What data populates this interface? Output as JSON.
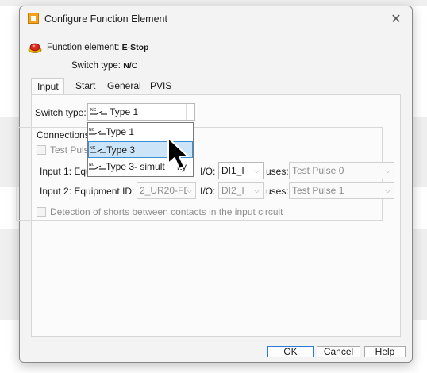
{
  "window": {
    "title": "Configure Function Element",
    "close_glyph": "✕"
  },
  "header": {
    "function_element_label": "Function element:",
    "function_element_value": "E-Stop",
    "switch_type_label": "Switch type:",
    "switch_type_value": "N/C"
  },
  "tabs": [
    {
      "label": "Input",
      "active": true
    },
    {
      "label": "Start"
    },
    {
      "label": "General"
    },
    {
      "label": "PVIS"
    }
  ],
  "form": {
    "switch_type_label": "Switch type:",
    "switch_type_value": "Type 1",
    "connections_label": "Connections",
    "test_pulse_label": "Test Pulse",
    "input1_label": "Input 1: Equ",
    "input2_label": "Input 2: Equipment ID:",
    "input2_equipment_value": "2_UR20-FE",
    "io_label": "I/O:",
    "input1_io_value": "DI1_I",
    "input2_io_value": "DI2_I",
    "uses_label": "uses:",
    "input1_uses_value": "Test Pulse 0",
    "input2_uses_value": "Test Pulse 1",
    "detection_label": "Detection of shorts between contacts in the input circuit"
  },
  "dropdown": {
    "options": [
      "Type 1",
      "Type 3",
      "Type 3- simult",
      "ity"
    ],
    "selected_index": 1
  },
  "buttons": {
    "ok": "OK",
    "cancel": "Cancel",
    "help": "Help"
  },
  "icons": {
    "app": "app-config-icon",
    "estop": "estop-icon",
    "nc_contact": "nc-contact-icon",
    "cursor": "mouse-pointer-icon"
  },
  "colors": {
    "selection_bg": "#cce4f7",
    "selection_border": "#3e8ed6",
    "accent": "#2f7ad6"
  }
}
